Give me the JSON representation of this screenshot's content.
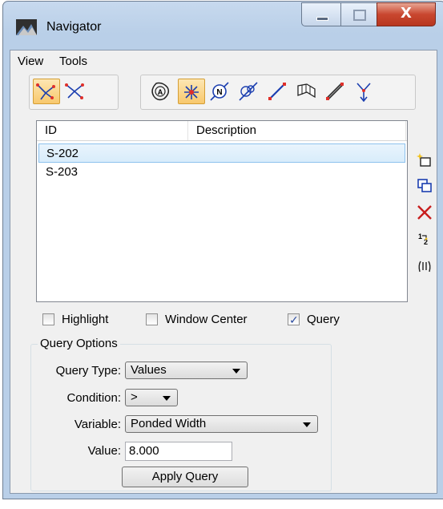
{
  "window": {
    "title": "Navigator",
    "close_glyph": "X"
  },
  "menu": {
    "items": [
      "View",
      "Tools"
    ]
  },
  "toolbar1": {
    "icons": [
      "network-select-icon",
      "network-all-icon"
    ]
  },
  "toolbar2": {
    "icons": [
      "area-a-icon",
      "highlighted-burst-icon",
      "node-n-icon",
      "line-segment-icon",
      "roadway-icon",
      "conduit-icon",
      "inlet-icon"
    ]
  },
  "list": {
    "columns": [
      "ID",
      "Description"
    ],
    "rows": [
      {
        "id": "S-202",
        "description": "",
        "selected": true
      },
      {
        "id": "S-203",
        "description": "",
        "selected": false
      }
    ]
  },
  "side_tools": [
    "add-item-icon",
    "copy-icon",
    "delete-icon",
    "renumber-icon",
    "parallel-icon"
  ],
  "options": {
    "highlight": {
      "label": "Highlight",
      "checked": false
    },
    "window_center": {
      "label": "Window Center",
      "checked": false
    },
    "query": {
      "label": "Query",
      "checked": true
    }
  },
  "query_options": {
    "title": "Query Options",
    "query_type": {
      "label": "Query Type:",
      "value": "Values"
    },
    "condition": {
      "label": "Condition:",
      "value": ">"
    },
    "variable": {
      "label": "Variable:",
      "value": "Ponded Width"
    },
    "value": {
      "label": "Value:",
      "value": "8.000"
    },
    "apply_label": "Apply Query"
  },
  "colors": {
    "accent_active": "#f8c86d",
    "selection": "#d8ecfb",
    "close_red": "#c9472f",
    "delete_red": "#c81e1e"
  }
}
